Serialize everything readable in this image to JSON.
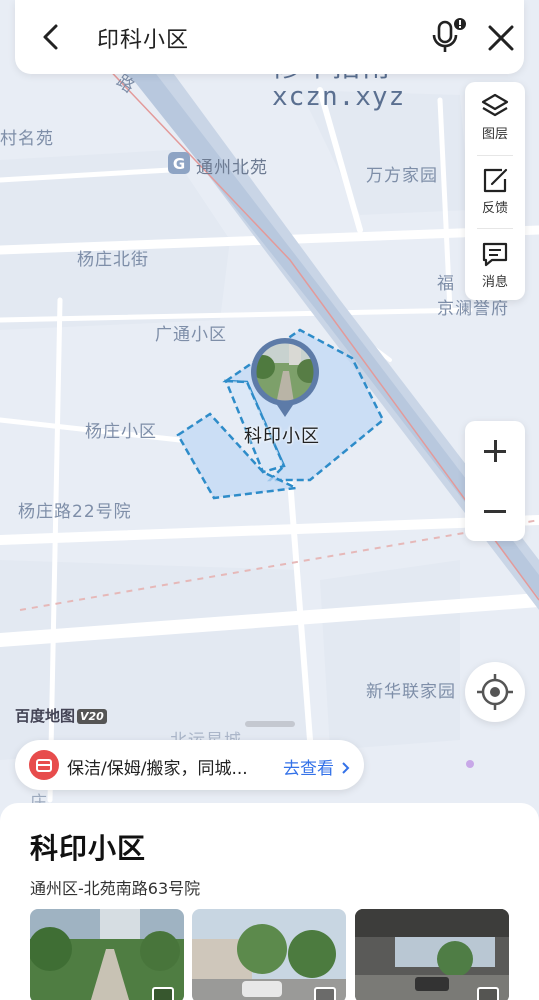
{
  "search": {
    "query": "印科小区"
  },
  "watermark": {
    "line1": "修车指南",
    "line2": "xczn.xyz"
  },
  "map": {
    "labels": {
      "road_partial": "路",
      "cun_ming_yuan": "村名苑",
      "tongzhou_beiyuan": "通州北苑",
      "wanfang_jiayuan": "万方家园",
      "yangzhuang_beijie": "杨庄北街",
      "fu_partial": "福",
      "jinglan_partial": "京澜誉府",
      "guangtong": "广通小区",
      "yangzhuang": "杨庄小区",
      "yangzhuang_22": "杨庄路22号院",
      "xinhua_lianjiayuan": "新华联家园",
      "bottom_partial": "北运星城",
      "bottom_left_partial": "庄"
    },
    "pin_label": "科印小区",
    "brand": {
      "name": "百度地图",
      "version": "V20"
    }
  },
  "toolbar": {
    "layers_label": "图层",
    "feedback_label": "反馈",
    "messages_label": "消息"
  },
  "promo": {
    "text": "保洁/保姆/搬家，同城...",
    "link": "去查看"
  },
  "sheet": {
    "title": "科印小区",
    "address": "通州区-北苑南路63号院"
  },
  "colors": {
    "accent": "#3472e8",
    "boundary": "#2e8cc9",
    "promo_icon": "#e74c4c"
  },
  "icons": [
    "back-arrow-icon",
    "mic-icon",
    "close-icon",
    "layers-icon",
    "feedback-icon",
    "message-icon",
    "zoom-in-icon",
    "zoom-out-icon",
    "locate-icon",
    "subway-icon",
    "promo-icon",
    "chevron-right-icon",
    "gallery-icon"
  ]
}
